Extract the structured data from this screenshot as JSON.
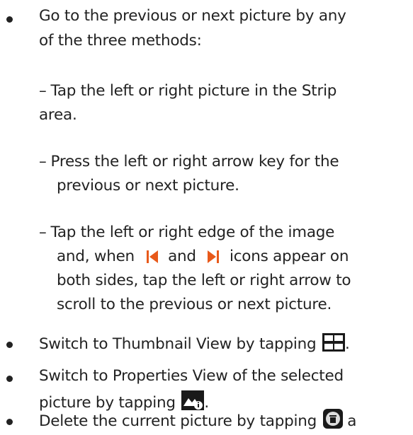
{
  "bullet1": {
    "line1": "Go to the previous or next picture by any",
    "line2": "of the three methods:",
    "method1": {
      "dash": "–",
      "line1": "Tap the left or right picture in the Strip",
      "line2": "area."
    },
    "method2": {
      "dash": "–",
      "line1": "Press the left or right arrow key for the",
      "line2": "previous or next picture."
    },
    "method3": {
      "dash": "–",
      "line1_a": "Tap the left or right edge of the image",
      "line2_a": "and, when",
      "line2_b": "and",
      "line2_c": "icons appear on",
      "line3": "both sides, tap the left or right arrow to",
      "line4": "scroll to the previous or next picture."
    }
  },
  "bullet2": {
    "text": "Switch to Thumbnail View by tapping",
    "after": "."
  },
  "bullet3": {
    "line1": "Switch to Properties View of the selected",
    "line2": "picture by tapping",
    "after": "."
  },
  "bullet4": {
    "text": "Delete the current picture by tapping",
    "after": "a"
  },
  "icons": {
    "prev": "previous-arrow-icon",
    "next": "next-arrow-icon",
    "thumbnail": "thumbnail-view-icon",
    "properties": "properties-view-icon",
    "delete": "delete-trash-icon"
  },
  "colors": {
    "arrow": "#e8591a",
    "text": "#222222"
  }
}
